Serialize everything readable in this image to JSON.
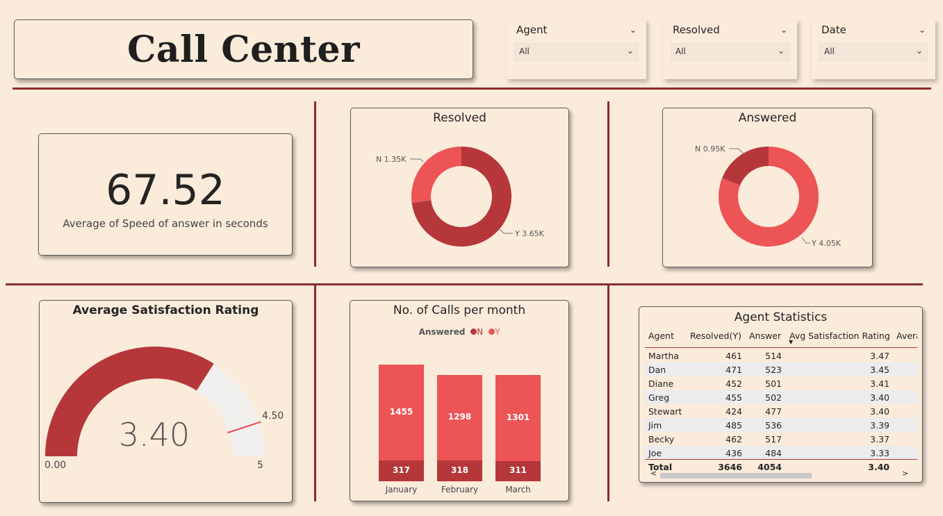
{
  "header": {
    "title": "Call Center"
  },
  "slicers": [
    {
      "label": "Agent",
      "value": "All"
    },
    {
      "label": "Resolved",
      "value": "All"
    },
    {
      "label": "Date",
      "value": "All"
    }
  ],
  "kpi": {
    "value": "67.52",
    "label": "Average of Speed of answer in seconds"
  },
  "colors": {
    "dark_red": "#b5373a",
    "light_red": "#ec5456",
    "background": "#faebdb",
    "divider": "#8b2b2b"
  },
  "resolved_donut": {
    "title": "Resolved",
    "labels": {
      "n": "N 1.35K",
      "y": "Y 3.65K"
    },
    "chart_data": {
      "type": "pie",
      "slices": [
        {
          "name": "N",
          "value": 1350
        },
        {
          "name": "Y",
          "value": 3650
        }
      ]
    }
  },
  "answered_donut": {
    "title": "Answered",
    "labels": {
      "n": "N 0.95K",
      "y": "Y 4.05K"
    },
    "chart_data": {
      "type": "pie",
      "slices": [
        {
          "name": "N",
          "value": 950
        },
        {
          "name": "Y",
          "value": 4050
        }
      ]
    }
  },
  "gauge": {
    "title": "Average Satisfaction Rating",
    "value_text": "3.40",
    "min_text": "0.00",
    "max_text": "5",
    "target_text": "4.50",
    "value": 3.4,
    "min": 0,
    "max": 5,
    "target": 4.5
  },
  "calls_chart": {
    "title": "No. of Calls per month",
    "legend_title": "Answered",
    "legend_items": [
      "N",
      "Y"
    ],
    "chart_data": {
      "type": "bar",
      "stacked": true,
      "categories": [
        "January",
        "February",
        "March"
      ],
      "series": [
        {
          "name": "N",
          "values": [
            317,
            318,
            311
          ]
        },
        {
          "name": "Y",
          "values": [
            1455,
            1298,
            1301
          ]
        }
      ]
    }
  },
  "agent_table": {
    "title": "Agent Statistics",
    "columns": [
      "Agent",
      "Resolved(Y)",
      "Answer",
      "Avg Satisfaction Rating",
      "Avera"
    ],
    "rows": [
      [
        "Martha",
        "461",
        "514",
        "3.47"
      ],
      [
        "Dan",
        "471",
        "523",
        "3.45"
      ],
      [
        "Diane",
        "452",
        "501",
        "3.41"
      ],
      [
        "Greg",
        "455",
        "502",
        "3.40"
      ],
      [
        "Stewart",
        "424",
        "477",
        "3.40"
      ],
      [
        "Jim",
        "485",
        "536",
        "3.39"
      ],
      [
        "Becky",
        "462",
        "517",
        "3.37"
      ],
      [
        "Joe",
        "436",
        "484",
        "3.33"
      ]
    ],
    "total": [
      "Total",
      "3646",
      "4054",
      "3.40"
    ],
    "scroll_left": "<",
    "scroll_right": ">"
  }
}
